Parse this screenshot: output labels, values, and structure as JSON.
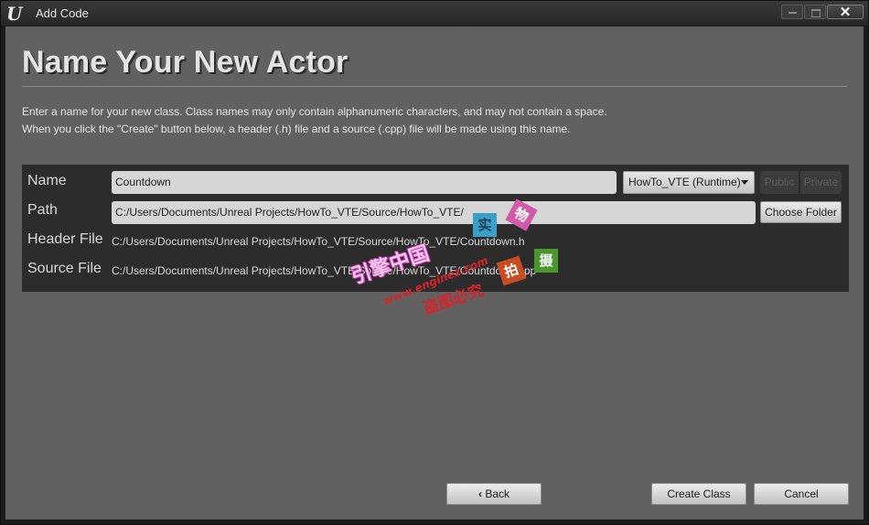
{
  "window": {
    "title": "Add Code",
    "logo": "U",
    "controls": {
      "minimize_icon": "minimize-icon",
      "maximize_icon": "maximize-icon",
      "close_icon": "close-icon",
      "close_glyph": "✕"
    }
  },
  "page": {
    "heading": "Name Your New Actor",
    "description_line1": "Enter a name for your new class. Class names may only contain alphanumeric characters, and may not contain a space.",
    "description_line2": "When you click the \"Create\" button below, a header (.h) file and a source (.cpp) file will be made using this name."
  },
  "form": {
    "name_label": "Name",
    "name_value": "Countdown",
    "module_dropdown": "HowTo_VTE (Runtime)",
    "visibility": {
      "public_label": "Public",
      "private_label": "Private"
    },
    "path_label": "Path",
    "path_value": "C:/Users/Documents/Unreal Projects/HowTo_VTE/Source/HowTo_VTE/",
    "choose_folder_label": "Choose Folder",
    "header_file_label": "Header File",
    "header_file_value": "C:/Users/Documents/Unreal Projects/HowTo_VTE/Source/HowTo_VTE/Countdown.h",
    "source_file_label": "Source File",
    "source_file_value": "C:/Users/Documents/Unreal Projects/HowTo_VTE/Source/HowTo_VTE/Countdown.cpp"
  },
  "footer": {
    "back_label": "Back",
    "back_glyph": "‹",
    "create_label": "Create Class",
    "cancel_label": "Cancel"
  },
  "watermark": {
    "c1": "实",
    "c2": "物",
    "c3": "拍",
    "c4": "摄",
    "brand": "引擎中国",
    "url": "www.enginez.com",
    "notice": "盗图必究"
  }
}
